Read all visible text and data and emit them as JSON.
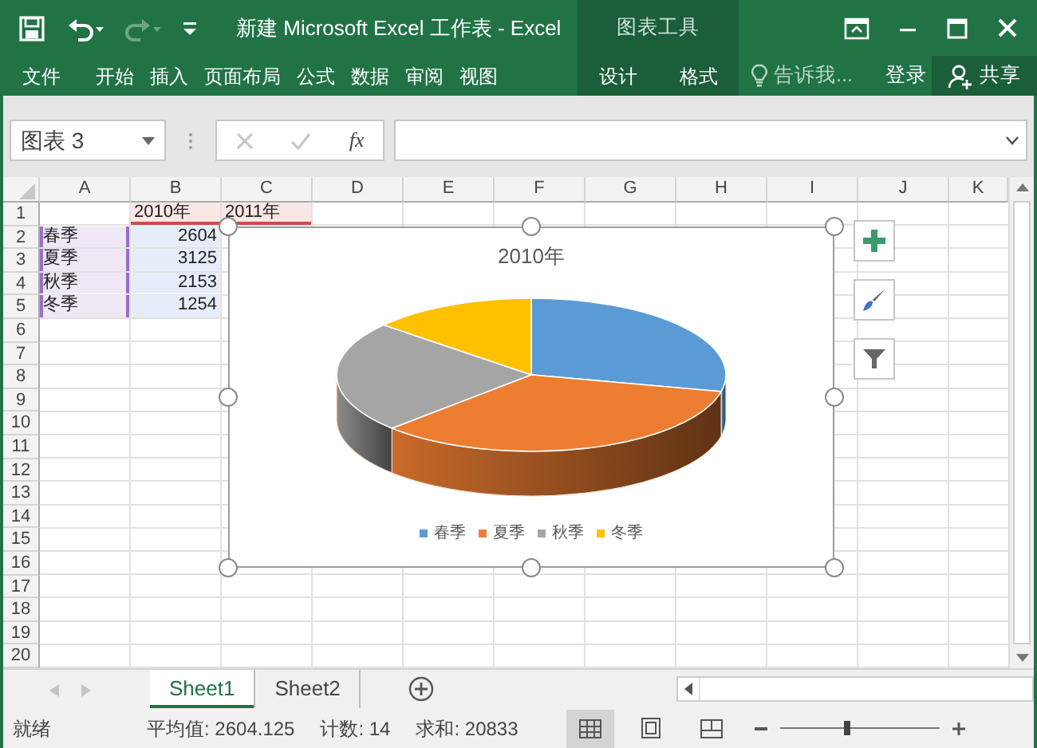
{
  "title_bar": {
    "title": "新建 Microsoft Excel 工作表 - Excel"
  },
  "quick_access": [
    {
      "kind": "save",
      "disabled": false
    },
    {
      "kind": "undo",
      "disabled": false
    },
    {
      "kind": "redo",
      "disabled": true
    },
    {
      "kind": "customize",
      "disabled": false
    }
  ],
  "ribbon_tabs": [
    {
      "label": "文件",
      "selected": false
    },
    {
      "label": "开始",
      "selected": false
    },
    {
      "label": "插入",
      "selected": false
    },
    {
      "label": "页面布局",
      "selected": false
    },
    {
      "label": "公式",
      "selected": false
    },
    {
      "label": "数据",
      "selected": false
    },
    {
      "label": "审阅",
      "selected": false
    },
    {
      "label": "视图",
      "selected": false
    }
  ],
  "context_group": {
    "label": "图表工具",
    "tabs": [
      {
        "label": "设计",
        "selected": false
      },
      {
        "label": "格式",
        "selected": false
      }
    ]
  },
  "tell_me": {
    "placeholder": "告诉我..."
  },
  "sign_in": "登录",
  "share": "共享",
  "formula_bar": {
    "name_box": "图表 3",
    "buttons": [
      {
        "kind": "cancel",
        "disabled": true
      },
      {
        "kind": "enter",
        "disabled": true
      }
    ],
    "function_label": "fx"
  },
  "sheet": {
    "columns": [
      "A",
      "B",
      "C",
      "D",
      "E",
      "F",
      "G",
      "H",
      "I",
      "J",
      "K"
    ],
    "rows": [
      {
        "number": "1",
        "cells": {
          "B": {
            "text": "2010年",
            "kind": "series-name"
          },
          "C": {
            "text": "2011年",
            "kind": "series-name"
          }
        }
      },
      {
        "number": "2",
        "cells": {
          "A": {
            "text": "春季",
            "kind": "category"
          },
          "B": {
            "text": "2604",
            "kind": "value"
          }
        }
      },
      {
        "number": "3",
        "cells": {
          "A": {
            "text": "夏季",
            "kind": "category"
          },
          "B": {
            "text": "3125",
            "kind": "value"
          }
        }
      },
      {
        "number": "4",
        "cells": {
          "A": {
            "text": "秋季",
            "kind": "category"
          },
          "B": {
            "text": "2153",
            "kind": "value"
          }
        }
      },
      {
        "number": "5",
        "cells": {
          "A": {
            "text": "冬季",
            "kind": "category"
          },
          "B": {
            "text": "1254",
            "kind": "value"
          }
        }
      },
      {
        "number": "6"
      },
      {
        "number": "7"
      },
      {
        "number": "8"
      },
      {
        "number": "9"
      },
      {
        "number": "10"
      },
      {
        "number": "11"
      },
      {
        "number": "12"
      },
      {
        "number": "13"
      },
      {
        "number": "14"
      },
      {
        "number": "15"
      },
      {
        "number": "16"
      },
      {
        "number": "17"
      },
      {
        "number": "18"
      },
      {
        "number": "19"
      },
      {
        "number": "20"
      }
    ]
  },
  "chart": {
    "title": "2010年",
    "legend": [
      {
        "label": "春季",
        "color": "#5b9bd5"
      },
      {
        "label": "夏季",
        "color": "#ed7d31"
      },
      {
        "label": "秋季",
        "color": "#a5a5a5"
      },
      {
        "label": "冬季",
        "color": "#ffc000"
      }
    ]
  },
  "sheet_nav": [
    {
      "kind": "prev",
      "disabled": true
    },
    {
      "kind": "next",
      "disabled": true
    }
  ],
  "sheet_tabs": [
    {
      "label": "Sheet1",
      "selected": true
    },
    {
      "label": "Sheet2",
      "selected": false
    }
  ],
  "status_bar": {
    "state": "就绪",
    "stats": [
      "平均值: 2604.125",
      "计数: 14",
      "求和: 20833"
    ],
    "views": [
      {
        "kind": "normal",
        "selected": true
      },
      {
        "kind": "page-layout",
        "selected": false
      },
      {
        "kind": "page-break",
        "selected": false
      }
    ],
    "zoom": {
      "level": 0.42
    }
  }
}
